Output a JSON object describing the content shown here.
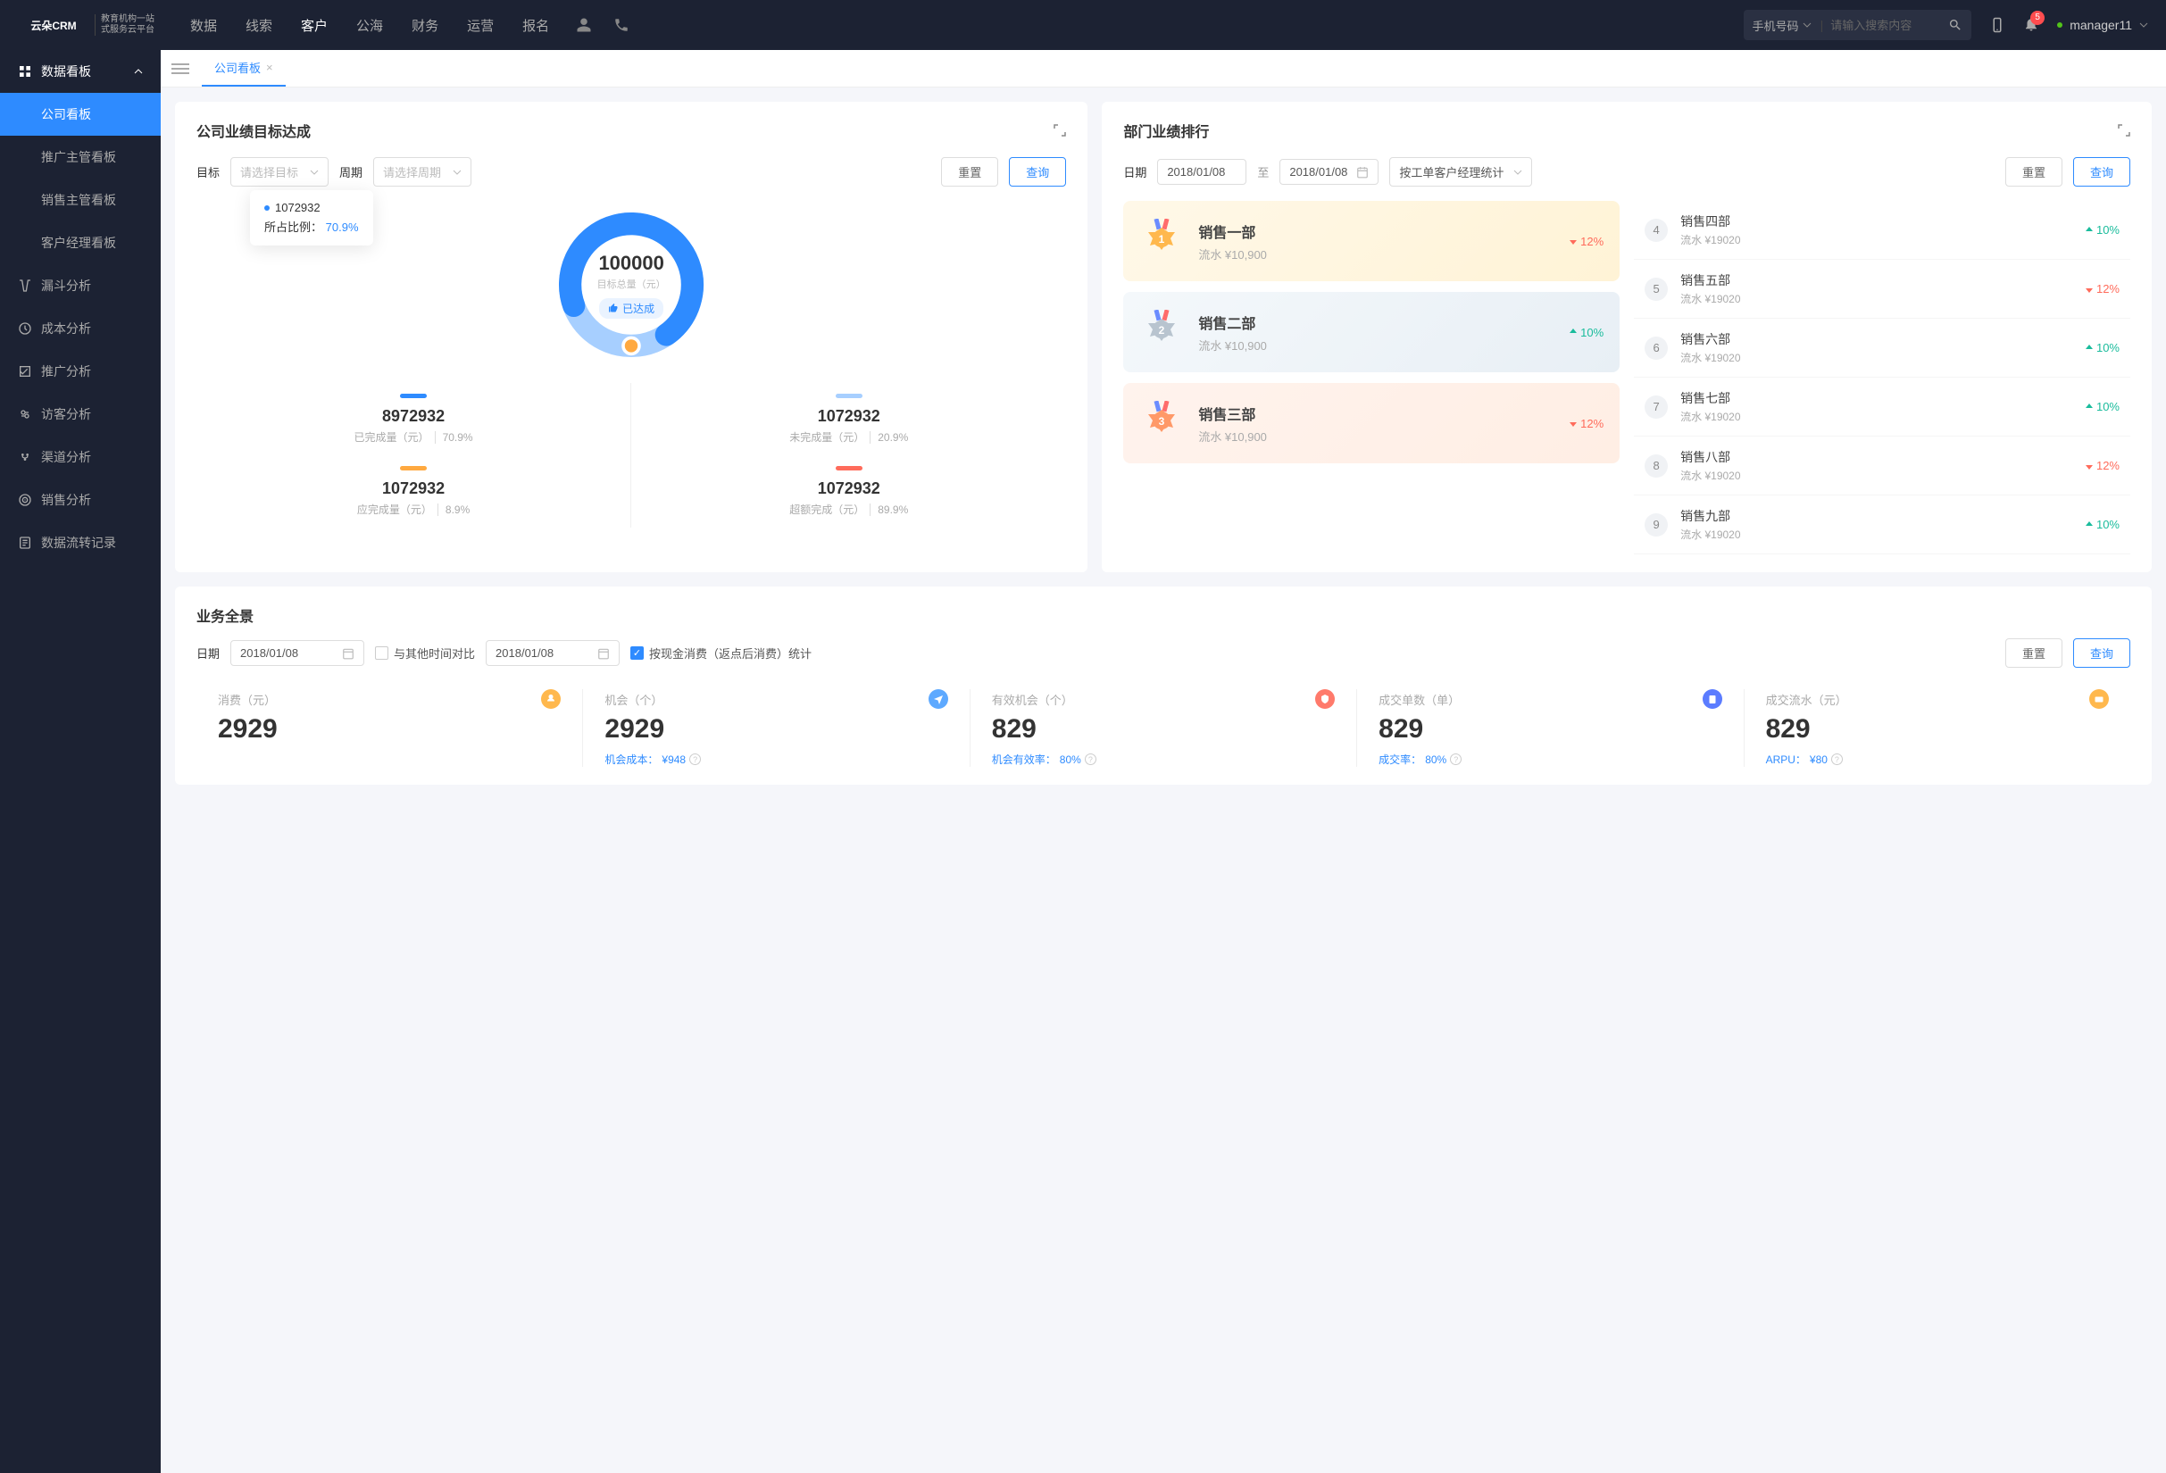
{
  "brand": {
    "name": "云朵CRM",
    "sub1": "教育机构一站",
    "sub2": "式服务云平台"
  },
  "topnav": {
    "items": [
      "数据",
      "线索",
      "客户",
      "公海",
      "财务",
      "运营",
      "报名"
    ],
    "active_index": 2,
    "search_type": "手机号码",
    "search_placeholder": "请输入搜索内容",
    "notif_count": "5",
    "username": "manager11"
  },
  "sidebar": {
    "group": "数据看板",
    "sub_items": [
      "公司看板",
      "推广主管看板",
      "销售主管看板",
      "客户经理看板"
    ],
    "active_sub": 0,
    "items": [
      "漏斗分析",
      "成本分析",
      "推广分析",
      "访客分析",
      "渠道分析",
      "销售分析",
      "数据流转记录"
    ]
  },
  "tabs": {
    "name": "公司看板"
  },
  "goal_card": {
    "title": "公司业绩目标达成",
    "target_label": "目标",
    "target_placeholder": "请选择目标",
    "period_label": "周期",
    "period_placeholder": "请选择周期",
    "reset": "重置",
    "query": "查询",
    "tooltip_val": "1072932",
    "tooltip_ratio_lbl": "所占比例：",
    "tooltip_ratio": "70.9%",
    "center_val": "100000",
    "center_lbl": "目标总量（元）",
    "badge": "已达成",
    "stats": [
      {
        "bar": "blue",
        "val": "8972932",
        "lbl": "已完成量（元）",
        "pct": "70.9%"
      },
      {
        "bar": "lightblue",
        "val": "1072932",
        "lbl": "未完成量（元）",
        "pct": "20.9%"
      },
      {
        "bar": "orange",
        "val": "1072932",
        "lbl": "应完成量（元）",
        "pct": "8.9%"
      },
      {
        "bar": "red",
        "val": "1072932",
        "lbl": "超额完成（元）",
        "pct": "89.9%"
      }
    ]
  },
  "chart_data": {
    "type": "pie",
    "title": "目标总量（元）",
    "total": 100000,
    "series": [
      {
        "name": "已完成量",
        "value": 8972932,
        "pct": 70.9,
        "color": "#2e8bff"
      },
      {
        "name": "未完成量",
        "value": 1072932,
        "pct": 20.9,
        "color": "#a7cfff"
      }
    ],
    "extras": [
      {
        "name": "应完成量",
        "value": 1072932,
        "pct": 8.9
      },
      {
        "name": "超额完成",
        "value": 1072932,
        "pct": 89.9
      }
    ]
  },
  "rank_card": {
    "title": "部门业绩排行",
    "date_label": "日期",
    "date_from": "2018/01/08",
    "date_sep": "至",
    "date_to": "2018/01/08",
    "stat_by": "按工单客户经理统计",
    "reset": "重置",
    "query": "查询",
    "top3": [
      {
        "name": "销售一部",
        "val": "流水 ¥10,900",
        "delta": "12%",
        "dir": "down"
      },
      {
        "name": "销售二部",
        "val": "流水 ¥10,900",
        "delta": "10%",
        "dir": "up"
      },
      {
        "name": "销售三部",
        "val": "流水 ¥10,900",
        "delta": "12%",
        "dir": "down"
      }
    ],
    "rest": [
      {
        "num": "4",
        "name": "销售四部",
        "val": "流水 ¥19020",
        "delta": "10%",
        "dir": "up"
      },
      {
        "num": "5",
        "name": "销售五部",
        "val": "流水 ¥19020",
        "delta": "12%",
        "dir": "down"
      },
      {
        "num": "6",
        "name": "销售六部",
        "val": "流水 ¥19020",
        "delta": "10%",
        "dir": "up"
      },
      {
        "num": "7",
        "name": "销售七部",
        "val": "流水 ¥19020",
        "delta": "10%",
        "dir": "up"
      },
      {
        "num": "8",
        "name": "销售八部",
        "val": "流水 ¥19020",
        "delta": "12%",
        "dir": "down"
      },
      {
        "num": "9",
        "name": "销售九部",
        "val": "流水 ¥19020",
        "delta": "10%",
        "dir": "up"
      }
    ]
  },
  "overview": {
    "title": "业务全景",
    "date_label": "日期",
    "date1": "2018/01/08",
    "compare_label": "与其他时间对比",
    "date2": "2018/01/08",
    "cash_label": "按现金消费（返点后消费）统计",
    "reset": "重置",
    "query": "查询",
    "kpis": [
      {
        "lbl": "消费（元）",
        "val": "2929",
        "icon_color": "#ffb84d",
        "sub": null
      },
      {
        "lbl": "机会（个）",
        "val": "2929",
        "icon_color": "#5da9ff",
        "sub": {
          "lbl": "机会成本：",
          "val": "¥948"
        }
      },
      {
        "lbl": "有效机会（个）",
        "val": "829",
        "icon_color": "#ff7a6b",
        "sub": {
          "lbl": "机会有效率：",
          "val": "80%"
        }
      },
      {
        "lbl": "成交单数（单）",
        "val": "829",
        "icon_color": "#5b7cff",
        "sub": {
          "lbl": "成交率：",
          "val": "80%"
        }
      },
      {
        "lbl": "成交流水（元）",
        "val": "829",
        "icon_color": "#ffb84d",
        "sub": {
          "lbl": "ARPU：",
          "val": "¥80"
        }
      }
    ]
  }
}
